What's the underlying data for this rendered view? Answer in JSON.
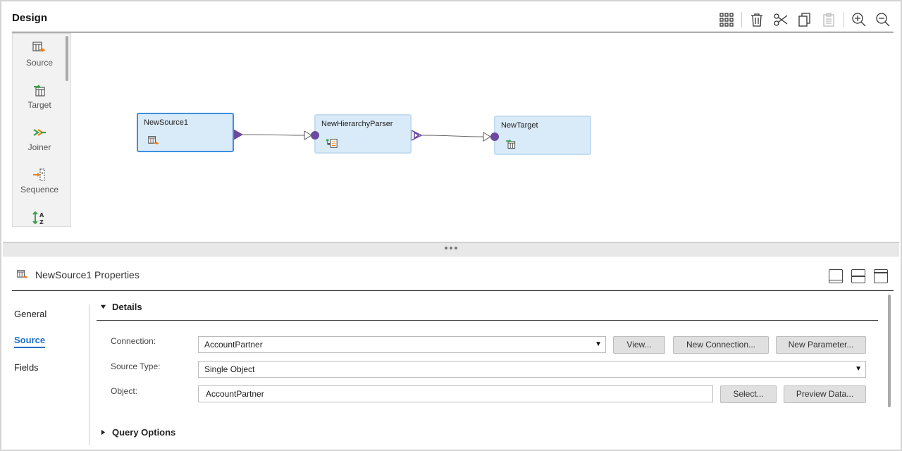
{
  "design": {
    "title": "Design",
    "toolbar": [
      "grid-icon",
      "trash-icon",
      "cut-icon",
      "copy-icon",
      "paste-icon",
      "zoom-in-icon",
      "zoom-out-icon"
    ]
  },
  "palette": {
    "items": [
      {
        "label": "Source",
        "icon": "source-icon"
      },
      {
        "label": "Target",
        "icon": "target-icon"
      },
      {
        "label": "Joiner",
        "icon": "joiner-icon"
      },
      {
        "label": "Sequence",
        "icon": "sequence-icon"
      },
      {
        "label": "",
        "icon": "sorter-icon"
      }
    ]
  },
  "canvas": {
    "nodes": [
      {
        "title": "NewSource1",
        "icon": "source-icon",
        "selected": true
      },
      {
        "title": "NewHierarchyParser",
        "icon": "hierarchy-parser-icon",
        "selected": false
      },
      {
        "title": "NewTarget",
        "icon": "target-icon",
        "selected": false
      }
    ]
  },
  "properties": {
    "title": "NewSource1 Properties",
    "nav": [
      {
        "label": "General",
        "active": false
      },
      {
        "label": "Source",
        "active": true
      },
      {
        "label": "Fields",
        "active": false
      }
    ],
    "details": {
      "section_label": "Details",
      "connection_label": "Connection:",
      "connection_value": "AccountPartner",
      "view_button": "View...",
      "new_connection_button": "New Connection...",
      "new_parameter_button": "New Parameter...",
      "source_type_label": "Source Type:",
      "source_type_value": "Single Object",
      "object_label": "Object:",
      "object_value": "AccountPartner",
      "select_button": "Select...",
      "preview_button": "Preview Data..."
    },
    "query_options_label": "Query Options"
  },
  "colors": {
    "accent": "#1f6fc8",
    "node_fill": "#d9eaf8",
    "port": "#6a4aa0"
  }
}
